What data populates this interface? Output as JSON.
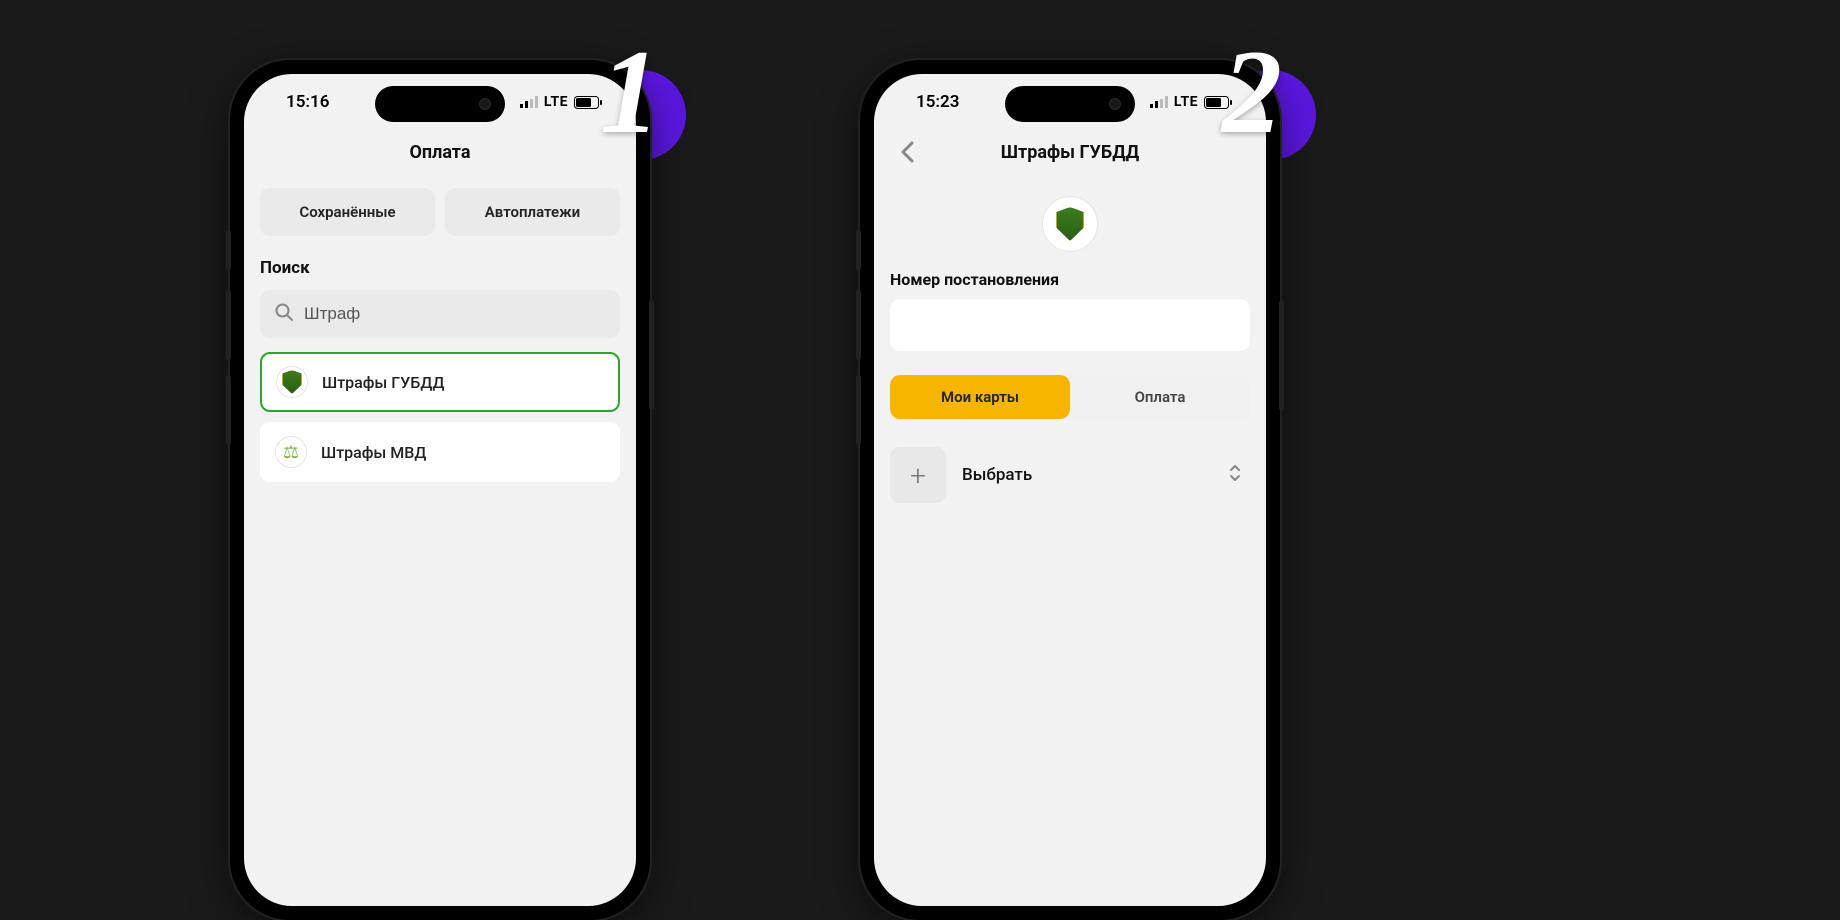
{
  "steps": {
    "one": "1",
    "two": "2"
  },
  "screen1": {
    "status": {
      "time": "15:16",
      "net": "LTE"
    },
    "title": "Оплата",
    "tabs": {
      "saved": "Сохранённые",
      "autopay": "Автоплатежи"
    },
    "search": {
      "label": "Поиск",
      "value": "Штраф"
    },
    "results": {
      "item0": {
        "label": "Штрафы ГУБДД"
      },
      "item1": {
        "label": "Штрафы МВД"
      }
    }
  },
  "screen2": {
    "status": {
      "time": "15:23",
      "net": "LTE"
    },
    "title": "Штрафы ГУБДД",
    "field_label": "Номер постановления",
    "toggle": {
      "mycards": "Мои карты",
      "payment": "Оплата"
    },
    "select_label": "Выбрать"
  }
}
